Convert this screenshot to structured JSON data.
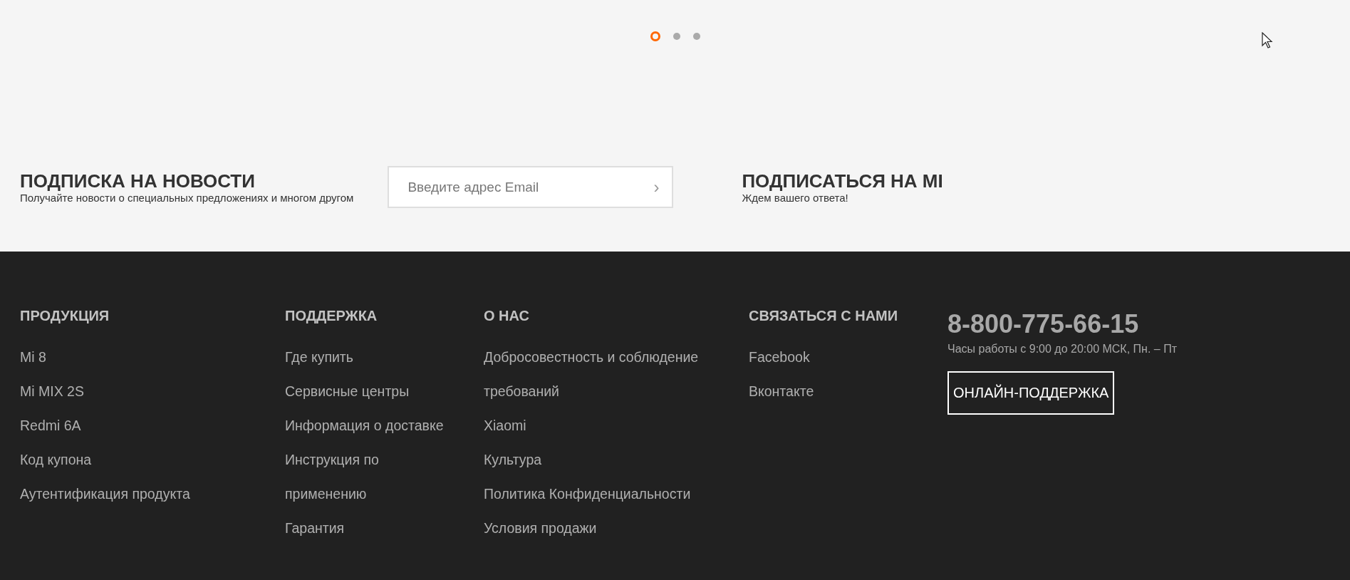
{
  "carousel": {
    "dots": [
      {
        "selected": true
      },
      {
        "selected": false
      },
      {
        "selected": false
      }
    ]
  },
  "newsletter": {
    "title": "ПОДПИСКА НА НОВОСТИ",
    "subtitle": "Получайте новости о специальных предложениях и многом другом",
    "email_field": {
      "placeholder": "Введите адрес Email",
      "submit": "›"
    },
    "follow_title": "ПОДПИСАТЬСЯ НА MI",
    "follow_subtitle": "Ждем вашего ответа!"
  },
  "footer": {
    "columns": [
      {
        "heading": "ПРОДУКЦИЯ",
        "links": [
          "Mi 8",
          "Mi MIX 2S",
          "Redmi 6A",
          "Код купона",
          "Аутентификация продукта"
        ]
      },
      {
        "heading": "ПОДДЕРЖКА",
        "links": [
          "Где купить",
          "Сервисные центры",
          "Информация о доставке",
          "Инструкция по применению",
          "Гарантия"
        ]
      },
      {
        "heading": "О НАС",
        "links": [
          "Добросовестность и соблюдение требований",
          "Xiaomi",
          "Культура",
          "Политика Конфиденциальности",
          "Условия продажи"
        ]
      },
      {
        "heading": "СВЯЗАТЬСЯ С НАМИ",
        "links": [
          "Facebook",
          "Вконтакте"
        ]
      }
    ],
    "contact": {
      "phone": "8-800-775-66-15",
      "hours": "Часы работы с 9:00 до 20:00 МСК, Пн. – Пт",
      "button": "ОНЛАЙН-ПОДДЕРЖКА"
    }
  }
}
